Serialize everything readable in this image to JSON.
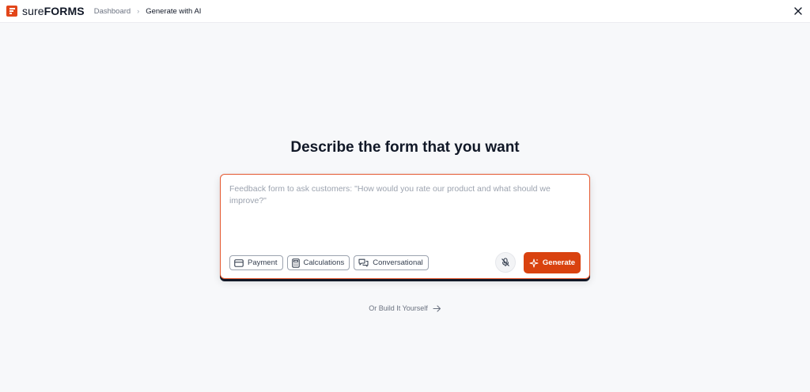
{
  "brand": {
    "name_bold": "sure",
    "name_caps": "FORMS",
    "accent": "#e2461a"
  },
  "breadcrumb": {
    "parent": "Dashboard",
    "separator": "›",
    "current": "Generate with AI"
  },
  "header": {
    "close_icon": "close-icon"
  },
  "main": {
    "heading": "Describe the form that you want",
    "prompt": {
      "placeholder": "Feedback form to ask customers: \"How would you rate our product and what should we improve?\"",
      "value": ""
    },
    "chips": [
      {
        "label": "Payment",
        "icon": "credit-card-icon"
      },
      {
        "label": "Calculations",
        "icon": "calculator-icon"
      },
      {
        "label": "Conversational",
        "icon": "chat-icon"
      }
    ],
    "mic_icon": "microphone-off-icon",
    "generate_label": "Generate",
    "generate_color": "#d9420f",
    "build_yourself": "Or Build It Yourself"
  }
}
